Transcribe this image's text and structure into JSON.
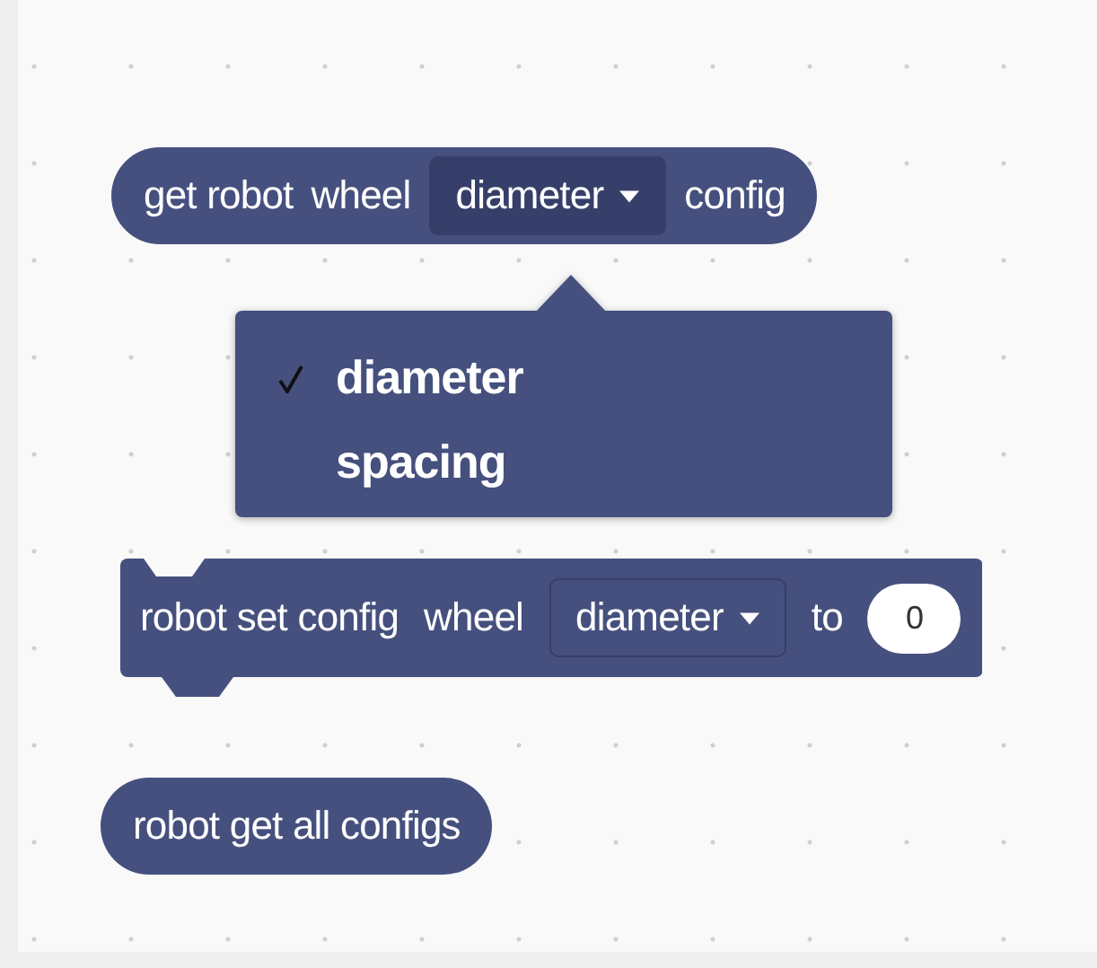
{
  "blocks": [
    {
      "kind": "reporter",
      "parts": [
        {
          "kind": "label",
          "text": "get robot"
        },
        {
          "kind": "label",
          "text": "wheel"
        },
        {
          "kind": "dropdown",
          "text": "diameter",
          "open": true
        },
        {
          "kind": "label",
          "text": "config"
        }
      ]
    },
    {
      "kind": "statement",
      "parts": [
        {
          "kind": "label",
          "text": "robot set config"
        },
        {
          "kind": "label",
          "text": "wheel"
        },
        {
          "kind": "dropdown",
          "text": "diameter",
          "open": false
        },
        {
          "kind": "label",
          "text": "to"
        },
        {
          "kind": "number",
          "text": "0"
        }
      ]
    },
    {
      "kind": "reporter",
      "parts": [
        {
          "kind": "label",
          "text": "robot get all configs"
        }
      ]
    }
  ],
  "dropdown_menu": {
    "items": [
      {
        "label": "diameter",
        "selected": true
      },
      {
        "label": "spacing",
        "selected": false
      }
    ]
  }
}
